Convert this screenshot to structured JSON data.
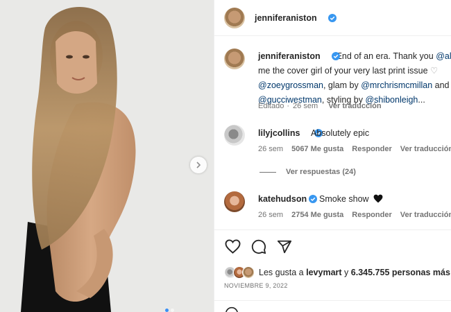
{
  "post": {
    "username": "jenniferaniston",
    "media": {
      "next_button": "chevron-right",
      "carousel_dots": 2
    }
  },
  "caption": {
    "username": "jenniferaniston",
    "line1": "End of an era. Thank you",
    "line1_mention": "@all",
    "line2": "me the cover girl of your very last print issue",
    "line3_mention1": "@zoeygrossman",
    "line3_text": ", glam by",
    "line3_mention2": "@mrchrismcmillan",
    "line3_tail": "and",
    "line4_mention1": "@gucciwestman",
    "line4_text": ", styling by",
    "line4_mention2": "@shibonleigh",
    "line4_ellipsis": "...",
    "edited": "Editado",
    "time": "26 sem",
    "translate": "Ver traducción"
  },
  "comments": [
    {
      "username": "lilyjcollins",
      "text": "Absolutely epic",
      "time": "26 sem",
      "likes": "5067 Me gusta",
      "reply": "Responder",
      "translate": "Ver traducción",
      "view_replies": "Ver respuestas (24)"
    },
    {
      "username": "katehudson",
      "text": "Smoke show",
      "emoji": "black-heart",
      "time": "26 sem",
      "likes": "2754 Me gusta",
      "reply": "Responder",
      "translate": "Ver traducción"
    }
  ],
  "likes": {
    "prefix": "Les gusta a",
    "user": "levymart",
    "connector": "y",
    "count": "6.345.755 personas más"
  },
  "date": "NOVIEMBRE 9, 2022",
  "colors": {
    "verified": "#3897f0",
    "link": "#00376b",
    "muted": "#737373"
  }
}
